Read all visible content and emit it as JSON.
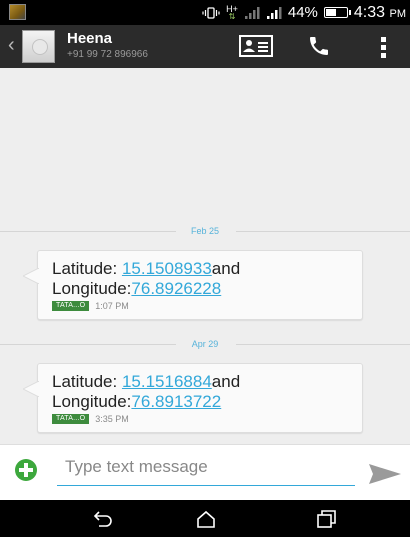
{
  "status_bar": {
    "network_type": "H+",
    "battery_percent": "44%",
    "battery_level": 0.44,
    "time": "4:33",
    "time_suffix": "PM",
    "icons": [
      "app-notification-icon",
      "vibrate-icon",
      "data-arrows-icon",
      "signal-icon",
      "signal-icon",
      "battery-icon"
    ]
  },
  "header": {
    "back_icon": "chevron-left-icon",
    "contact_name": "Heena",
    "contact_number": "+91 99 72 896966",
    "actions": [
      "contact-card-icon",
      "phone-icon",
      "overflow-menu-icon"
    ]
  },
  "conversation": {
    "groups": [
      {
        "date": "Feb 25",
        "message": {
          "line1_prefix": "Latitude: ",
          "latitude": "15.1508933",
          "line1_suffix": "and",
          "line2_prefix": "Longitude:",
          "longitude": "76.8926228",
          "sim_label": "TATA...O",
          "time": "1:07 PM"
        }
      },
      {
        "date": "Apr 29",
        "message": {
          "line1_prefix": "Latitude: ",
          "latitude": "15.1516884",
          "line1_suffix": "and",
          "line2_prefix": "Longitude:",
          "longitude": "76.8913722",
          "sim_label": "TATA...O",
          "time": "3:35 PM"
        }
      }
    ]
  },
  "composer": {
    "placeholder": "Type text message",
    "value": "",
    "add_icon": "add-attachment-icon",
    "send_icon": "send-icon"
  },
  "nav_bar": {
    "buttons": [
      "back-icon",
      "home-icon",
      "recent-apps-icon"
    ]
  },
  "colors": {
    "accent": "#33a8d9",
    "app_bar": "#2b2b2b",
    "conversation_bg": "#eeeeee",
    "add_green": "#3da83d",
    "sim_badge": "#3d8b3d"
  }
}
